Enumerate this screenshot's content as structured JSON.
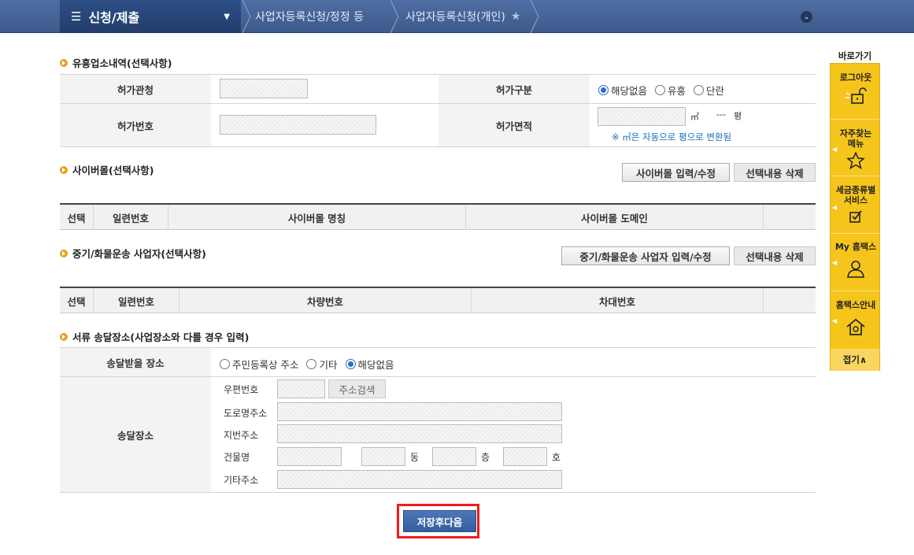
{
  "topbar": {
    "menu_label": "신청/제출",
    "crumb1": "사업자등록신청/정정 등",
    "crumb2": "사업자등록신청(개인)"
  },
  "section_entertainment": {
    "title": "유흥업소내역(선택사항)",
    "permit_office_label": "허가관청",
    "permit_type_label": "허가구분",
    "permit_type_options": [
      "해당없음",
      "유흥",
      "단란"
    ],
    "permit_type_selected": "해당없음",
    "permit_number_label": "허가번호",
    "permit_area_label": "허가면적",
    "area_unit_m2": "㎡",
    "area_pyeong_value": "---",
    "area_unit_pyeong": "평",
    "area_note": "※ ㎡은 자동으로 평으로 변환됨"
  },
  "section_cybermall": {
    "title": "사이버몰(선택사항)",
    "input_button": "사이버몰 입력/수정",
    "delete_button": "선택내용 삭제",
    "columns": [
      "선택",
      "일련번호",
      "사이버몰 명칭",
      "사이버몰 도메인"
    ]
  },
  "section_truck": {
    "title": "중기/화물운송 사업자(선택사항)",
    "input_button": "중기/화물운송 사업자 입력/수정",
    "delete_button": "선택내용 삭제",
    "columns": [
      "선택",
      "일련번호",
      "차량번호",
      "차대번호"
    ]
  },
  "section_delivery": {
    "title": "서류 송달장소(사업장소와 다를 경우 입력)",
    "place_label": "송달받을 장소",
    "place_options": [
      "주민등록상 주소",
      "기타",
      "해당없음"
    ],
    "place_selected": "해당없음",
    "address_label": "송달장소",
    "zip_label": "우편번호",
    "address_search_button": "주소검색",
    "road_address_label": "도로명주소",
    "lot_address_label": "지번주소",
    "building_label": "건물명",
    "dong_label": "동",
    "floor_label": "층",
    "ho_label": "호",
    "other_address_label": "기타주소"
  },
  "save_button": "저장후다음",
  "quick_panel": {
    "title": "바로가기",
    "logout": "로그아웃",
    "favorites_line1": "자주찾는",
    "favorites_line2": "메뉴",
    "tax_service_line1": "세금종류별",
    "tax_service_line2": "서비스",
    "my_hometax": "My 홈택스",
    "hometax_guide": "홈택스안내",
    "fold": "접기∧"
  }
}
